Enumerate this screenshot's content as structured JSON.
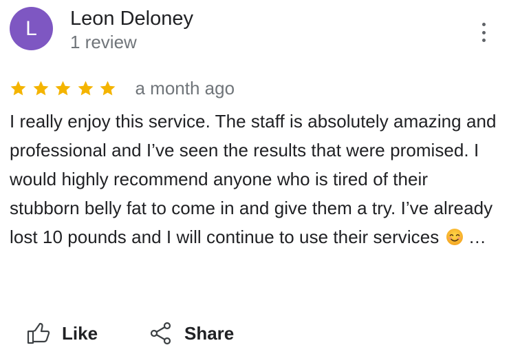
{
  "reviewer": {
    "avatar_initial": "L",
    "avatar_color": "#7e57c2",
    "name": "Leon Deloney",
    "review_count": "1 review"
  },
  "more_menu_icon": "more-vert-icon",
  "rating": {
    "stars": 5,
    "max_stars": 5,
    "star_color": "#f4b400",
    "date": "a month ago"
  },
  "review": {
    "text": "I really enjoy this service. The staff is absolutely amazing and professional and I’ve seen the results that were promised. I would highly recommend anyone who is tired of their stubborn belly fat to come in and give them a try. I’ve already lost 10 pounds and I will continue to use their services",
    "emoji": "smiling-face-emoji",
    "ellipsis": "…"
  },
  "actions": {
    "like_label": "Like",
    "like_icon": "thumbs-up-icon",
    "share_label": "Share",
    "share_icon": "share-icon"
  }
}
